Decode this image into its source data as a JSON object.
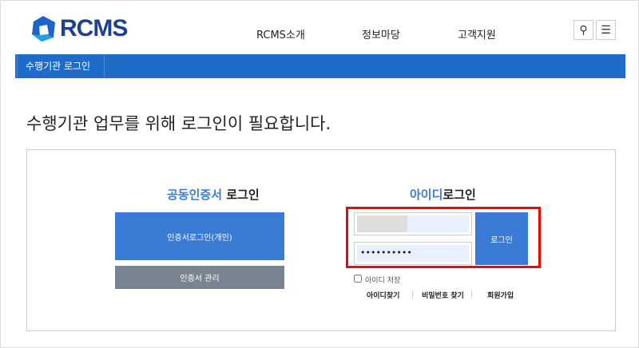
{
  "header": {
    "logo": "RCMS",
    "nav": [
      "RCMS소개",
      "정보마당",
      "고객지원"
    ],
    "search_icon": "search-icon",
    "menu_icon": "hamburger-icon"
  },
  "breadcrumb": "수행기관 로그인",
  "page_title": "수행기관 업무를 위해 로그인이 필요합니다.",
  "cert": {
    "title_hl": "공동인증서",
    "title_rest": " 로그인",
    "login_button": "인증서로그인(개인)",
    "manage_button": "인증서 관리"
  },
  "id_login": {
    "title_hl": "아이디",
    "title_rest": "로그인",
    "username_value": "",
    "password_value": "••••••••••",
    "login_button": "로그인",
    "remember_label": "아이디 저장",
    "links": [
      "아이디찾기",
      "비밀번호 찾기",
      "회원가입"
    ]
  },
  "colors": {
    "primary": "#1f6cc8",
    "button": "#3a7bd5",
    "gray_button": "#7a8490",
    "highlight": "#ff0000"
  }
}
